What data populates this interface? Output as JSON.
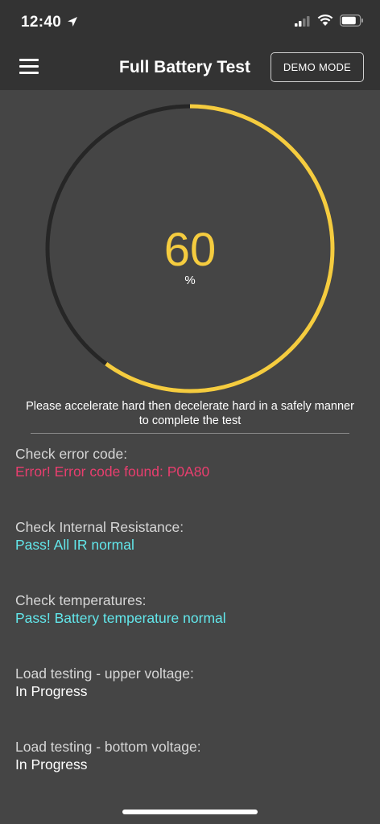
{
  "status_bar": {
    "time": "12:40",
    "icons": [
      "location-arrow-icon",
      "signal-icon",
      "wifi-icon",
      "battery-icon"
    ]
  },
  "header": {
    "title": "Full Battery Test",
    "demo_button": "DEMO MODE",
    "menu_icon": "hamburger-menu-icon"
  },
  "gauge": {
    "value": "60",
    "unit": "%",
    "progress_fraction": 0.6,
    "colors": {
      "progress": "#f5cc3f",
      "track": "#262626"
    }
  },
  "instructions": "Please accelerate hard then decelerate hard in a safely manner to complete the test",
  "checks": [
    {
      "label": "Check error code:",
      "result": "Error!  Error code found: P0A80",
      "status": "error",
      "color": "#e83e6e"
    },
    {
      "label": "Check Internal Resistance:",
      "result": "Pass!  All IR normal",
      "status": "pass",
      "color": "#62e6ea"
    },
    {
      "label": "Check temperatures:",
      "result": "Pass!  Battery temperature normal",
      "status": "pass",
      "color": "#62e6ea"
    },
    {
      "label": "Load testing - upper voltage:",
      "result": "In Progress",
      "status": "progress",
      "color": "#ffffff"
    },
    {
      "label": "Load testing - bottom voltage:",
      "result": "In Progress",
      "status": "progress",
      "color": "#ffffff"
    }
  ]
}
